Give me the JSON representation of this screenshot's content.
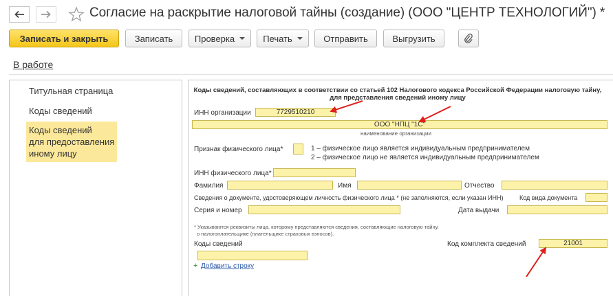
{
  "window": {
    "title": "Согласие на раскрытие налоговой тайны (создание) (ООО \"ЦЕНТР ТЕХНОЛОГИЙ\") *"
  },
  "toolbar": {
    "save_close": "Записать и закрыть",
    "save": "Записать",
    "check": "Проверка",
    "print": "Печать",
    "send": "Отправить",
    "export": "Выгрузить"
  },
  "status": "В работе",
  "sidebar": {
    "items": [
      {
        "label": "Титульная страница"
      },
      {
        "label": "Коды сведений"
      },
      {
        "label": "Коды сведений\nдля предоставления\nиному лицу"
      }
    ]
  },
  "form": {
    "heading": "Коды сведений, составляющих в соответствии со статьей 102 Налогового кодекса Российской Федерации налоговую тайну, для представления сведений иному лицу",
    "inn_org_label": "ИНН организации",
    "inn_org_value": "7729510210",
    "org_name_value": "ООО \"НПЦ \"1С\"",
    "org_name_caption": "наименование организации",
    "individual_flag_label": "Признак физического лица*",
    "individual_flag_value": "",
    "flag_option_1": "1 – физическое лицо является индивидуальным предпринимателем",
    "flag_option_2": "2 – физическое лицо не является индивидуальным предпринимателем",
    "inn_person_label": "ИНН физического лица*",
    "inn_person_value": "",
    "surname_label": "Фамилия",
    "surname_value": "",
    "name_label": "Имя",
    "name_value": "",
    "patronymic_label": "Отчество",
    "patronymic_value": "",
    "doc_info_label": "Сведения о документе, удостоверяющем личность физического лица * (не заполняются, если указан ИНН)",
    "doc_type_label": "Код вида документа",
    "doc_type_value": "",
    "series_label": "Серия и номер",
    "series_value": "",
    "issue_date_label": "Дата выдачи",
    "issue_date_value": "",
    "footnote_1": "* Указываются реквизиты лица, которому представляются сведения, составляющие налоговую тайну,",
    "footnote_2": "о налогоплательщике (плательщике страховых взносов).",
    "codes_label": "Коды сведений",
    "codes_value": "",
    "kit_code_label": "Код комплекта сведений",
    "kit_code_value": "21001",
    "add_row": "Добавить строку"
  },
  "colors": {
    "primary_button": "#f4c61a",
    "input_fill": "#fdf2a9",
    "active_nav": "#fbe89a",
    "annotation_arrow": "#e0201c"
  },
  "icons": {
    "back": "arrow-left-icon",
    "forward": "arrow-right-icon",
    "favorite": "star-icon",
    "attach": "paperclip-icon",
    "plus": "plus-icon"
  }
}
